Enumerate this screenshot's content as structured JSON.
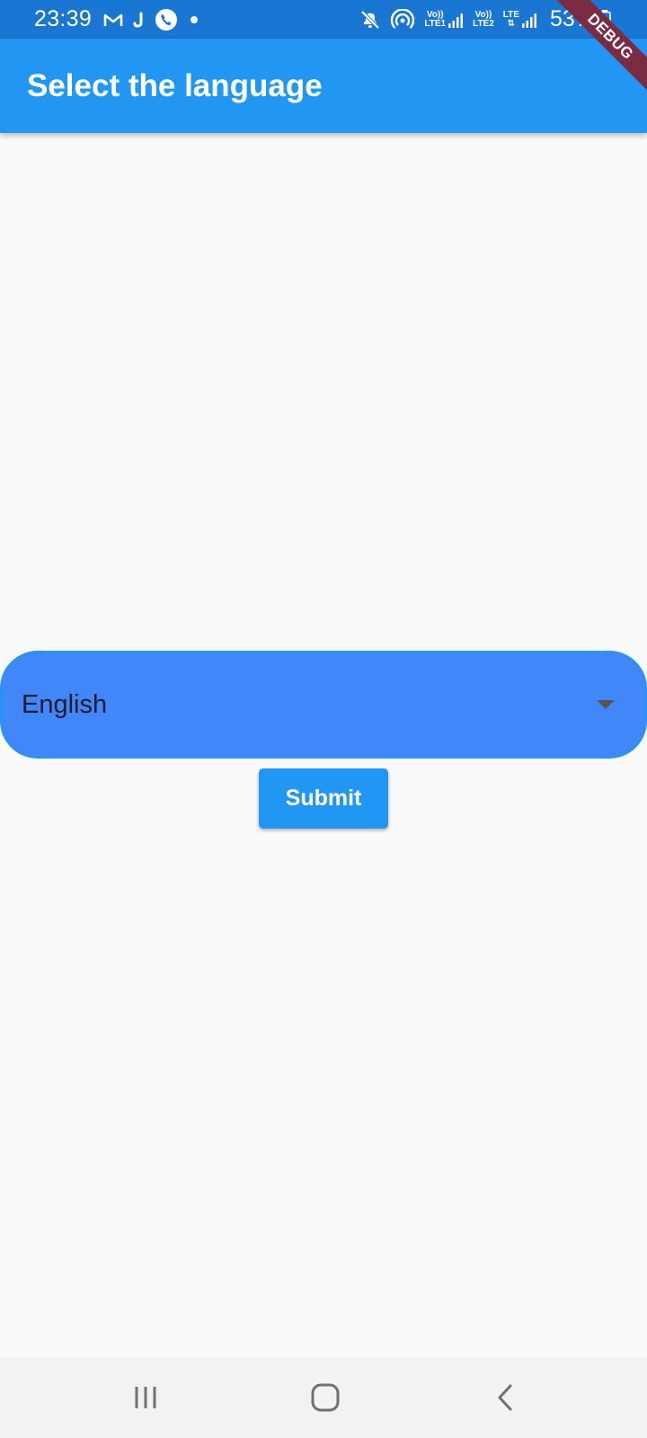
{
  "status_bar": {
    "time": "23:39",
    "battery_percent": "53%",
    "left_icons": [
      "gmail-icon",
      "jio-icon",
      "phone-call-icon",
      "notification-dot-icon"
    ],
    "right_icons": [
      "mute-icon",
      "hotspot-icon",
      "volte-lte1-signal-icon",
      "volte-lte2-signal-icon",
      "lte-data-signal-icon",
      "battery-icon"
    ],
    "sim1_label_top": "Vo))",
    "sim1_label_bottom": "LTE1",
    "sim2_label_top": "Vo))",
    "sim2_label_bottom": "LTE2",
    "data_label": "LTE"
  },
  "app_bar": {
    "title": "Select the language"
  },
  "debug_banner": {
    "label": "DEBUG"
  },
  "language_dropdown": {
    "selected_value": "English"
  },
  "submit_button": {
    "label": "Submit"
  },
  "navigation_bar": {
    "buttons": [
      "recent-apps-icon",
      "home-icon",
      "back-icon"
    ]
  },
  "colors": {
    "status_bar": "#1976D2",
    "app_bar": "#2196F3",
    "dropdown_fill": "#4287F9",
    "dropdown_border": "#2196F3",
    "debug_banner": "#7B2C43",
    "background": "#FAFAFA",
    "nav_bar": "#F2F2F2"
  }
}
